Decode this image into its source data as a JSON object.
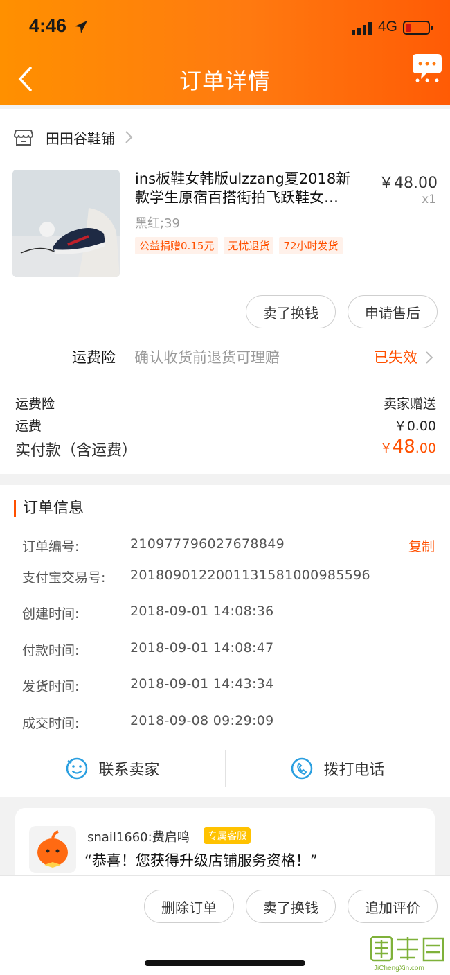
{
  "status_bar": {
    "time": "4:46",
    "network": "4G"
  },
  "header": {
    "title": "订单详情"
  },
  "shop": {
    "name": "田田谷鞋铺"
  },
  "product": {
    "title": "ins板鞋女韩版ulzzang夏2018新款学生原宿百搭街拍飞跃鞋女…",
    "price": "￥48.00",
    "quantity": "x1",
    "sku": "黑红;39",
    "tags": [
      "公益捐赠0.15元",
      "无忧退货",
      "72小时发货"
    ],
    "thumb_colors": {
      "bg": "#d8dee2",
      "shoe": "#1e2a44",
      "stripe": "#c0202a"
    }
  },
  "actions": {
    "sell_for_cash": "卖了换钱",
    "after_sale": "申请售后"
  },
  "insurance": {
    "label": "运费险",
    "desc": "确认收货前退货可理赔",
    "status": "已失效"
  },
  "fees": {
    "insurance_label": "运费险",
    "insurance_value": "卖家赠送",
    "shipping_label": "运费",
    "shipping_value": "￥0.00",
    "total_label": "实付款（含运费）",
    "total_currency": "￥",
    "total_int": "48",
    "total_dec": ".00"
  },
  "order_info": {
    "heading": "订单信息",
    "copy_label": "复制",
    "rows": [
      {
        "label": "订单编号:",
        "value": "210977796027678849"
      },
      {
        "label": "支付宝交易号:",
        "value": "2018090122001131581000985596"
      },
      {
        "label": "创建时间:",
        "value": "2018-09-01 14:08:36"
      },
      {
        "label": "付款时间:",
        "value": "2018-09-01 14:08:47"
      },
      {
        "label": "发货时间:",
        "value": "2018-09-01 14:43:34"
      },
      {
        "label": "成交时间:",
        "value": "2018-09-08 09:29:09"
      }
    ]
  },
  "contact": {
    "seller": "联系卖家",
    "phone": "拨打电话"
  },
  "service": {
    "name": "snail1660:费启鸣",
    "badge": "专属客服",
    "message": "“恭喜！您获得升级店铺服务资格！”"
  },
  "bottom_actions": {
    "delete": "删除订单",
    "sell": "卖了换钱",
    "review": "追加评价"
  },
  "watermark": {
    "text": "JiChengXin.com"
  },
  "colors": {
    "accent": "#ff5000",
    "header_start": "#ff9000",
    "header_end": "#ff5b05"
  }
}
